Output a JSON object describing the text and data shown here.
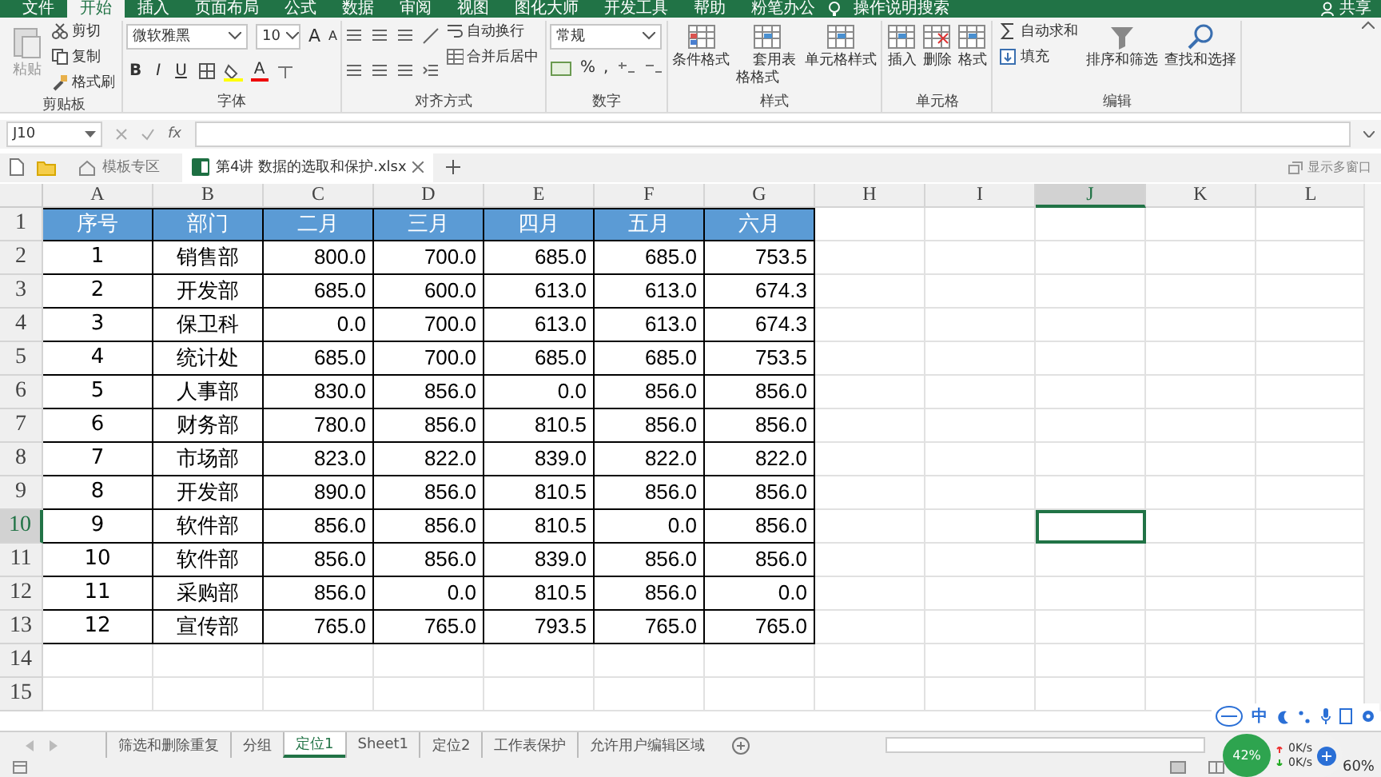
{
  "menu_tabs": [
    {
      "label": "文件",
      "selected": false
    },
    {
      "label": "开始",
      "selected": true
    },
    {
      "label": "插入",
      "selected": false
    },
    {
      "label": "页面布局",
      "selected": false
    },
    {
      "label": "公式",
      "selected": false
    },
    {
      "label": "数据",
      "selected": false
    },
    {
      "label": "审阅",
      "selected": false
    },
    {
      "label": "视图",
      "selected": false
    },
    {
      "label": "图化大师",
      "selected": false
    },
    {
      "label": "开发工具",
      "selected": false
    },
    {
      "label": "帮助",
      "selected": false
    },
    {
      "label": "粉笔办公",
      "selected": false
    },
    {
      "label": "操作说明搜索",
      "selected": false
    }
  ],
  "share": "共享",
  "ribbon": [
    {
      "kind": "clipboard",
      "title": "剪贴板",
      "paste": "粘贴",
      "items": [
        "剪切",
        "复制",
        "格式刷"
      ]
    },
    {
      "kind": "font",
      "title": "字体",
      "font_name": "微软雅黑",
      "font_size": "10",
      "size_buttons": [
        "A",
        "A"
      ],
      "format_buttons": [
        "B",
        "I",
        "U"
      ],
      "color_button": "A"
    },
    {
      "kind": "alignment",
      "title": "对齐方式",
      "items": [
        "自动换行",
        "合并后居中"
      ]
    },
    {
      "kind": "number",
      "title": "数字",
      "format": "常规",
      "symbols": [
        "%",
        ","
      ]
    },
    {
      "kind": "styles",
      "title": "样式",
      "buttons": [
        "条件格式",
        "套用表格格式",
        "单元格样式"
      ]
    },
    {
      "kind": "cells",
      "title": "单元格",
      "buttons": [
        "插入",
        "删除",
        "格式"
      ]
    },
    {
      "kind": "editing",
      "title": "编辑",
      "items": [
        "自动求和",
        "填充"
      ],
      "buttons": [
        "排序和筛选",
        "查找和选择"
      ]
    }
  ],
  "formula_bar": {
    "name_box": "J10",
    "fx": "fx"
  },
  "doc_tabs": [
    {
      "kind": "home",
      "label": "模板专区",
      "selected": false
    },
    {
      "kind": "file",
      "label": "第4讲 数据的选取和保护.xlsx",
      "selected": true
    }
  ],
  "window_button": "显示多窗口",
  "sheet": {
    "columns": [
      {
        "label": "A",
        "selected": false
      },
      {
        "label": "B",
        "selected": false
      },
      {
        "label": "C",
        "selected": false
      },
      {
        "label": "D",
        "selected": false
      },
      {
        "label": "E",
        "selected": false
      },
      {
        "label": "F",
        "selected": false
      },
      {
        "label": "G",
        "selected": false
      },
      {
        "label": "H",
        "selected": false
      },
      {
        "label": "I",
        "selected": false
      },
      {
        "label": "J",
        "selected": true
      },
      {
        "label": "K",
        "selected": false
      },
      {
        "label": "L",
        "selected": false
      }
    ],
    "rows": [
      {
        "label": "1",
        "selected": false,
        "kind": "header",
        "cells": [
          "序号",
          "部门",
          "二月",
          "三月",
          "四月",
          "五月",
          "六月"
        ]
      },
      {
        "label": "2",
        "selected": false,
        "kind": "data",
        "cells": [
          "1",
          "销售部",
          "800.0",
          "700.0",
          "685.0",
          "685.0",
          "753.5"
        ]
      },
      {
        "label": "3",
        "selected": false,
        "kind": "data",
        "cells": [
          "2",
          "开发部",
          "685.0",
          "600.0",
          "613.0",
          "613.0",
          "674.3"
        ]
      },
      {
        "label": "4",
        "selected": false,
        "kind": "data",
        "cells": [
          "3",
          "保卫科",
          "0.0",
          "700.0",
          "613.0",
          "613.0",
          "674.3"
        ]
      },
      {
        "label": "5",
        "selected": false,
        "kind": "data",
        "cells": [
          "4",
          "统计处",
          "685.0",
          "700.0",
          "685.0",
          "685.0",
          "753.5"
        ]
      },
      {
        "label": "6",
        "selected": false,
        "kind": "data",
        "cells": [
          "5",
          "人事部",
          "830.0",
          "856.0",
          "0.0",
          "856.0",
          "856.0"
        ]
      },
      {
        "label": "7",
        "selected": false,
        "kind": "data",
        "cells": [
          "6",
          "财务部",
          "780.0",
          "856.0",
          "810.5",
          "856.0",
          "856.0"
        ]
      },
      {
        "label": "8",
        "selected": false,
        "kind": "data",
        "cells": [
          "7",
          "市场部",
          "823.0",
          "822.0",
          "839.0",
          "822.0",
          "822.0"
        ]
      },
      {
        "label": "9",
        "selected": false,
        "kind": "data",
        "cells": [
          "8",
          "开发部",
          "890.0",
          "856.0",
          "810.5",
          "856.0",
          "856.0"
        ]
      },
      {
        "label": "10",
        "selected": true,
        "kind": "data",
        "cells": [
          "9",
          "软件部",
          "856.0",
          "856.0",
          "810.5",
          "0.0",
          "856.0"
        ]
      },
      {
        "label": "11",
        "selected": false,
        "kind": "data",
        "cells": [
          "10",
          "软件部",
          "856.0",
          "856.0",
          "839.0",
          "856.0",
          "856.0"
        ]
      },
      {
        "label": "12",
        "selected": false,
        "kind": "data",
        "cells": [
          "11",
          "采购部",
          "856.0",
          "0.0",
          "810.5",
          "856.0",
          "0.0"
        ]
      },
      {
        "label": "13",
        "selected": false,
        "kind": "data",
        "cells": [
          "12",
          "宣传部",
          "765.0",
          "765.0",
          "793.5",
          "765.0",
          "765.0"
        ]
      },
      {
        "label": "14",
        "selected": false
      },
      {
        "label": "15",
        "selected": false
      }
    ]
  },
  "sheet_tabs": [
    {
      "label": "筛选和删除重复",
      "selected": false
    },
    {
      "label": "分组",
      "selected": false
    },
    {
      "label": "定位1",
      "selected": true
    },
    {
      "label": "Sheet1",
      "selected": false
    },
    {
      "label": "定位2",
      "selected": false
    },
    {
      "label": "工作表保护",
      "selected": false
    },
    {
      "label": "允许用户编辑区域",
      "selected": false
    }
  ],
  "status": {
    "zoom": "60%"
  },
  "ime_bar": {
    "mode": "中"
  },
  "net_widget": {
    "usage": "42%",
    "upload": "0K/s",
    "download": "0K/s"
  }
}
